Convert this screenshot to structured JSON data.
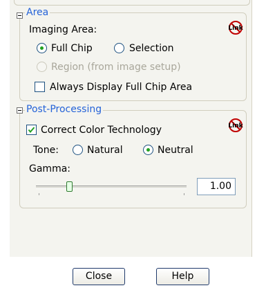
{
  "area": {
    "title": "Area",
    "imaging_area_label": "Imaging Area:",
    "options": [
      {
        "label": "Full Chip",
        "selected": true,
        "enabled": true
      },
      {
        "label": "Selection",
        "selected": false,
        "enabled": true
      },
      {
        "label": "Region (from image setup)",
        "selected": false,
        "enabled": false
      }
    ],
    "always_display_label": "Always Display Full Chip Area",
    "always_display_checked": false,
    "link_icon": "link-disabled-icon",
    "link_icon_text": "Link"
  },
  "post_processing": {
    "title": "Post-Processing",
    "correct_color_label": "Correct Color Technology",
    "correct_color_checked": true,
    "tone_label": "Tone:",
    "tone_options": [
      {
        "label": "Natural",
        "selected": false
      },
      {
        "label": "Neutral",
        "selected": true
      }
    ],
    "gamma_label": "Gamma:",
    "gamma_value": "1.00",
    "link_icon": "link-disabled-icon",
    "link_icon_text": "Link"
  },
  "footer": {
    "close_label": "Close",
    "help_label": "Help"
  },
  "colors": {
    "group_title": "#2563d8",
    "radio_selected": "#21a121",
    "panel_bg": "#f4f4ef"
  }
}
